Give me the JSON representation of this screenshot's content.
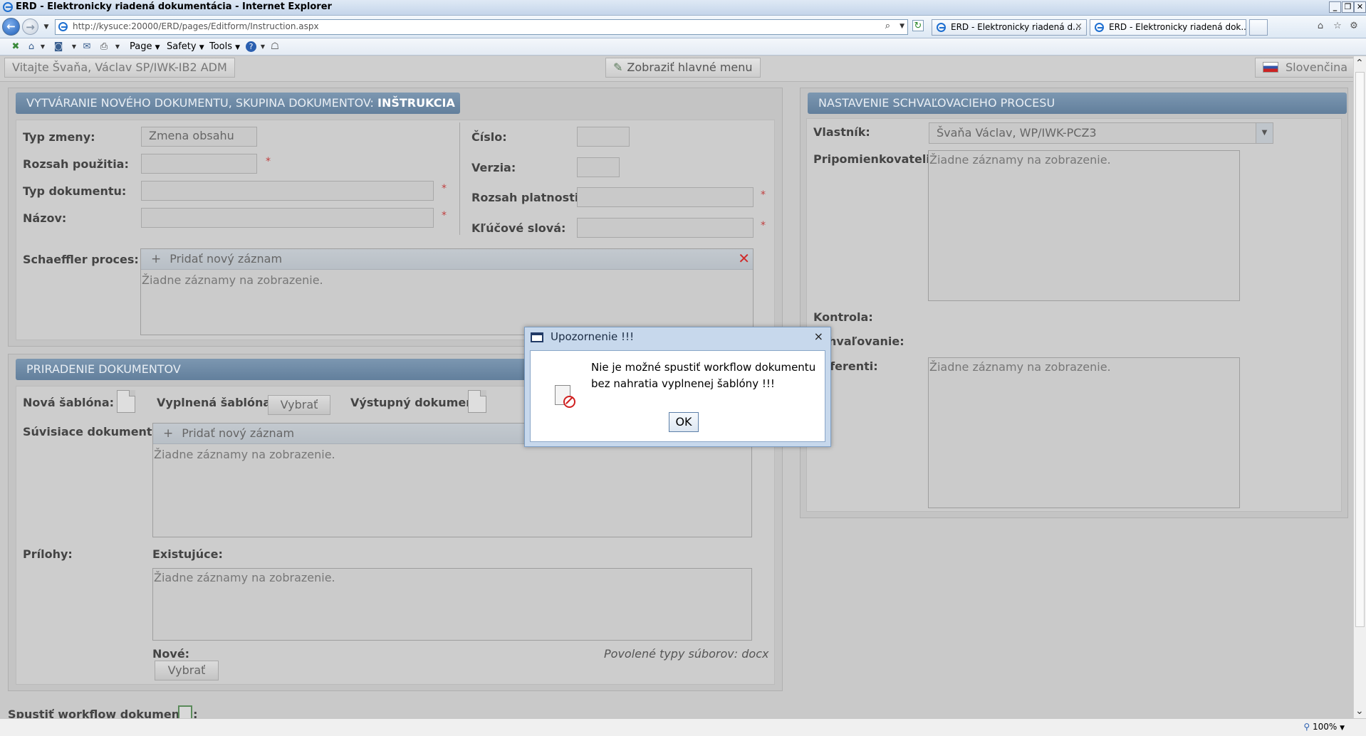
{
  "window": {
    "title": "ERD - Elektronicky riadená dokumentácia - Internet Explorer",
    "address": "http://kysuce:20000/ERD/pages/Editform/Instruction.aspx",
    "tabs": [
      "ERD - Elektronicky riadená d...",
      "ERD - Elektronicky riadená dok..."
    ]
  },
  "menu": {
    "page": "Page",
    "safety": "Safety",
    "tools": "Tools"
  },
  "header": {
    "welcome": "Vitajte Švaňa, Václav SP/IWK-IB2 ADM",
    "main_menu": "Zobraziť hlavné menu",
    "language": "Slovenčina"
  },
  "create_panel": {
    "title_prefix": "VYTVÁRANIE NOVÉHO DOKUMENTU, SKUPINA DOKUMENTOV:",
    "title_group": "INŠTRUKCIA",
    "labels": {
      "change_type": "Typ zmeny:",
      "usage_scope": "Rozsah použitia:",
      "doc_type": "Typ dokumentu:",
      "name": "Názov:",
      "number": "Číslo:",
      "version": "Verzia:",
      "validity_scope": "Rozsah platnosti:",
      "keywords": "Kľúčové slová:",
      "process": "Schaeffler proces:"
    },
    "change_type_value": "Zmena obsahu",
    "add_record": "Pridať nový záznam",
    "empty": "Žiadne záznamy na zobrazenie."
  },
  "assign_panel": {
    "title": "PRIRADENIE DOKUMENTOV",
    "labels": {
      "new_template": "Nová šablóna:",
      "filled_template": "Vyplnená šablóna:",
      "output_doc": "Výstupný dokument:",
      "related_docs": "Súvisiace dokumenty:",
      "attachments": "Prílohy:",
      "existing": "Existujúce:",
      "new": "Nové:"
    },
    "select": "Vybrať",
    "add_record": "Pridať nový záznam",
    "empty": "Žiadne záznamy na zobrazenie.",
    "allowed_types": "Povolené typy súborov: docx"
  },
  "approval_panel": {
    "title": "NASTAVENIE SCHVAĽOVACIEHO PROCESU",
    "labels": {
      "owner": "Vlastník:",
      "reviewers": "Pripomienkovatelia:",
      "control": "Kontrola:",
      "approval": "Schvaľovanie:",
      "referents": "Referenti:"
    },
    "owner_value": "Švaňa Václav, WP/IWK-PCZ3",
    "empty": "Žiadne záznamy na zobrazenie."
  },
  "footer": {
    "start_workflow": "Spustiť workflow dokumentu:"
  },
  "modal": {
    "title": "Upozornenie !!!",
    "message": "Nie je možné spustiť workflow dokumentu bez nahratia vyplnenej šablóny !!!",
    "ok": "OK"
  },
  "status": {
    "zoom": "100%"
  }
}
